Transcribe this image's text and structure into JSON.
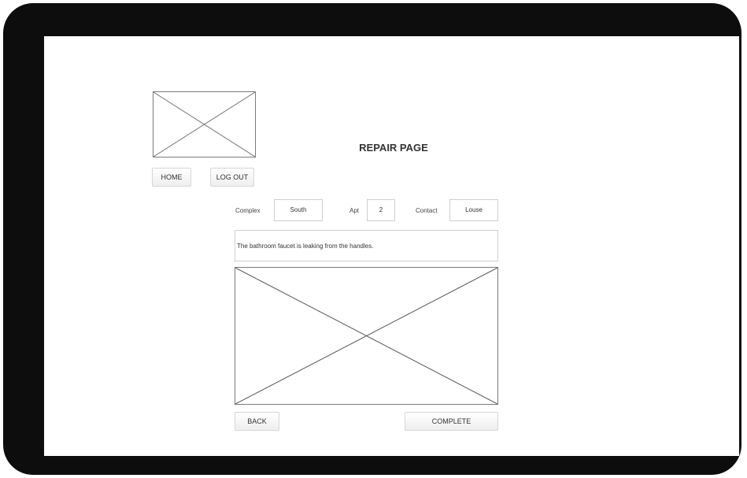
{
  "header": {
    "logo_icon": "image-placeholder-icon",
    "title": "REPAIR PAGE",
    "home_label": "HOME",
    "logout_label": "LOG OUT"
  },
  "details": {
    "complex_label": "Complex",
    "complex_value": "South",
    "apt_label": "Apt",
    "apt_value": "2",
    "contact_label": "Contact",
    "contact_value": "Louse"
  },
  "description": "The bathroom faucet is leaking from the handles.",
  "photo_icon": "image-placeholder-icon",
  "footer": {
    "back_label": "BACK",
    "complete_label": "COMPLETE"
  },
  "colors": {
    "frame": "#0d0d0d",
    "screen": "#ffffff",
    "placeholder_line": "#7a7a7a"
  }
}
